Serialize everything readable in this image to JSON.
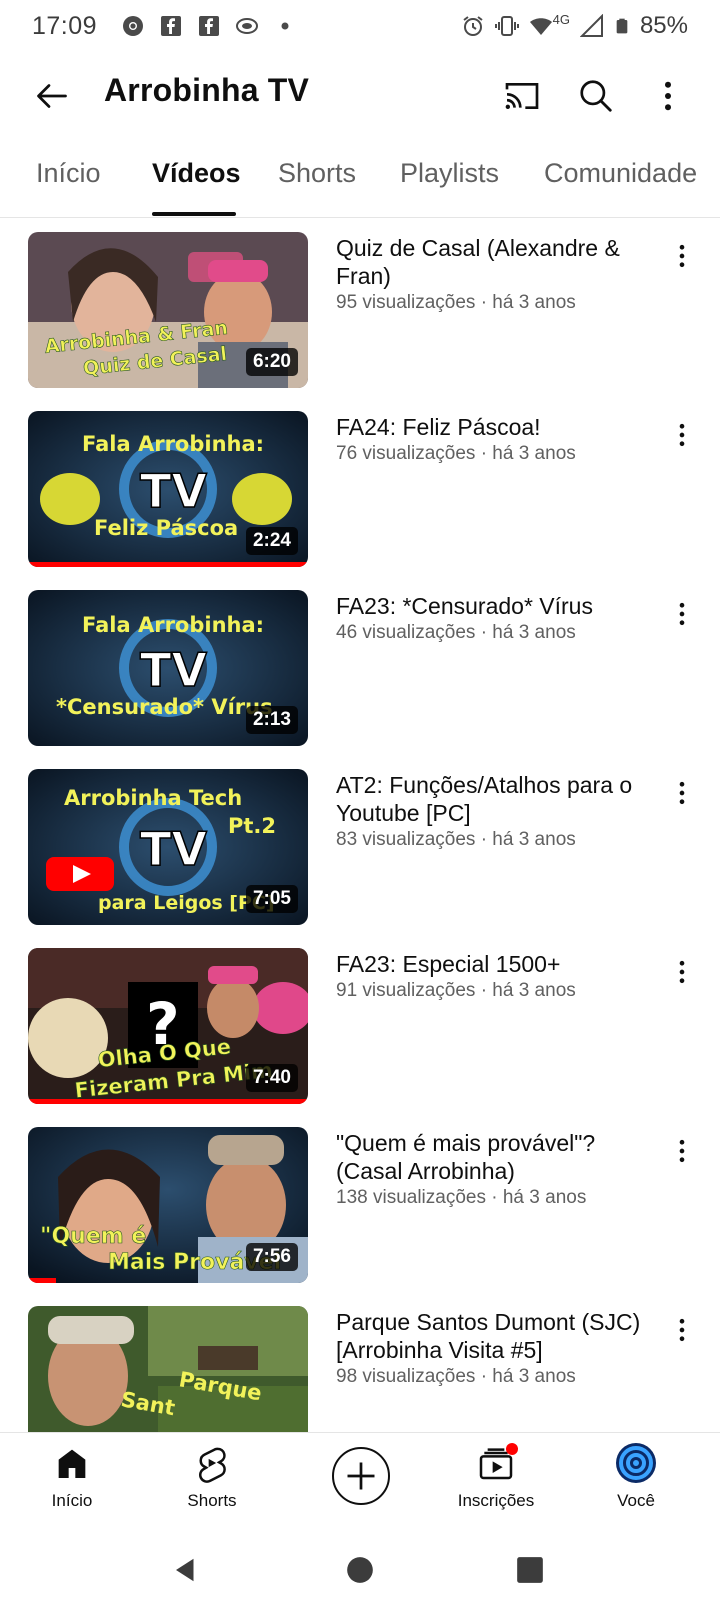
{
  "status_bar": {
    "time": "17:09",
    "network": "4G",
    "battery": "85%",
    "icons": [
      "chrome-icon",
      "facebook-icon",
      "facebook-icon",
      "link-icon",
      "dot-icon",
      "alarm-icon",
      "vibrate-icon",
      "wifi-icon",
      "signal-icon",
      "battery-icon"
    ]
  },
  "header": {
    "title": "Arrobinha TV",
    "icons": [
      "back-arrow-icon",
      "cast-icon",
      "search-icon",
      "more-vert-icon"
    ]
  },
  "tabs": [
    {
      "label": "Início",
      "active": false
    },
    {
      "label": "Vídeos",
      "active": true
    },
    {
      "label": "Shorts",
      "active": false
    },
    {
      "label": "Playlists",
      "active": false
    },
    {
      "label": "Comunidade",
      "active": false
    }
  ],
  "videos": [
    {
      "title": "Quiz de Casal (Alexandre & Fran)",
      "meta": "95 visualizações · há 3 anos",
      "duration": "6:20",
      "thumb_text": [
        "Arrobinha & Fran",
        "Quiz de Casal"
      ],
      "progress": 0
    },
    {
      "title": "FA24: Feliz Páscoa!",
      "meta": "76 visualizações · há 3 anos",
      "duration": "2:24",
      "thumb_text": [
        "Fala Arrobinha:",
        "Feliz Páscoa"
      ],
      "progress": 1.0
    },
    {
      "title": "FA23: *Censurado* Vírus",
      "meta": "46 visualizações · há 3 anos",
      "duration": "2:13",
      "thumb_text": [
        "Fala Arrobinha:",
        "*Censurado* Vírus"
      ],
      "progress": 0
    },
    {
      "title": "AT2: Funções/Atalhos para o Youtube [PC]",
      "meta": "83 visualizações · há 3 anos",
      "duration": "7:05",
      "thumb_text": [
        "Arrobinha Tech",
        "Pt.2",
        "para Leigos [PC]"
      ],
      "progress": 0
    },
    {
      "title": "FA23: Especial 1500+",
      "meta": "91 visualizações · há 3 anos",
      "duration": "7:40",
      "thumb_text": [
        "Olha O Que",
        "Fizeram Pra Mim"
      ],
      "progress": 1.0
    },
    {
      "title": "\"Quem é mais provável\"? (Casal Arrobinha)",
      "meta": "138 visualizações · há 3 anos",
      "duration": "7:56",
      "thumb_text": [
        "\"Quem é",
        "Mais Provável"
      ],
      "progress": 0.1
    },
    {
      "title": "Parque Santos Dumont (SJC) [Arrobinha Visita #5]",
      "meta": "98 visualizações · há 3 anos",
      "duration": "",
      "thumb_text": [
        "Parque",
        "Sant"
      ],
      "progress": 0
    }
  ],
  "bottom_nav": [
    {
      "label": "Início",
      "icon": "home-icon"
    },
    {
      "label": "Shorts",
      "icon": "shorts-icon"
    },
    {
      "label": "",
      "icon": "create-icon"
    },
    {
      "label": "Inscrições",
      "icon": "subscriptions-icon"
    },
    {
      "label": "Você",
      "icon": "avatar-icon"
    }
  ],
  "colors": {
    "accent": "#ff0000",
    "text_primary": "#0f0f0f",
    "text_secondary": "#606060",
    "thumb_text": "#f2f25a"
  }
}
